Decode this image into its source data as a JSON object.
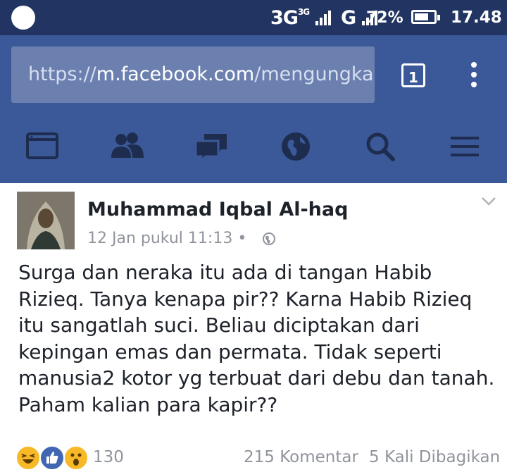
{
  "status_bar": {
    "network": "3G",
    "network_small": "3G",
    "carrier_g": "G",
    "battery_percent": "72%",
    "battery_level": 0.72,
    "time": "17.48"
  },
  "browser": {
    "url_scheme": "https://",
    "url_host": "m.facebook.com",
    "url_path": "/mengungka",
    "tab_count": "1"
  },
  "fb_nav": {
    "icons": [
      "news-feed-icon",
      "friends-icon",
      "messages-icon",
      "notifications-globe-icon",
      "search-icon",
      "menu-icon"
    ]
  },
  "post": {
    "author": "Muhammad Iqbal Al-haq",
    "date": "12 Jan pukul 11:13",
    "separator": "•",
    "privacy_icon": "globe-icon",
    "text": "Surga dan neraka itu ada di tangan Habib Rizieq. Tanya kenapa pir?? Karna Habib Rizieq itu sangatlah suci. Beliau diciptakan dari kepingan emas dan permata. Tidak seperti manusia2 kotor yg terbuat dari debu dan tanah. Paham kalian para kapir??",
    "reaction_icons": [
      "haha-icon",
      "like-icon",
      "wow-icon"
    ],
    "reaction_count": "130",
    "comments": "215 Komentar",
    "shares": "5 Kali Dibagikan"
  },
  "colors": {
    "status_bar": "#223462",
    "facebook_blue": "#3b5998",
    "url_box": "#6c80b0",
    "text": "#1d2129",
    "meta_gray": "#90949c"
  }
}
